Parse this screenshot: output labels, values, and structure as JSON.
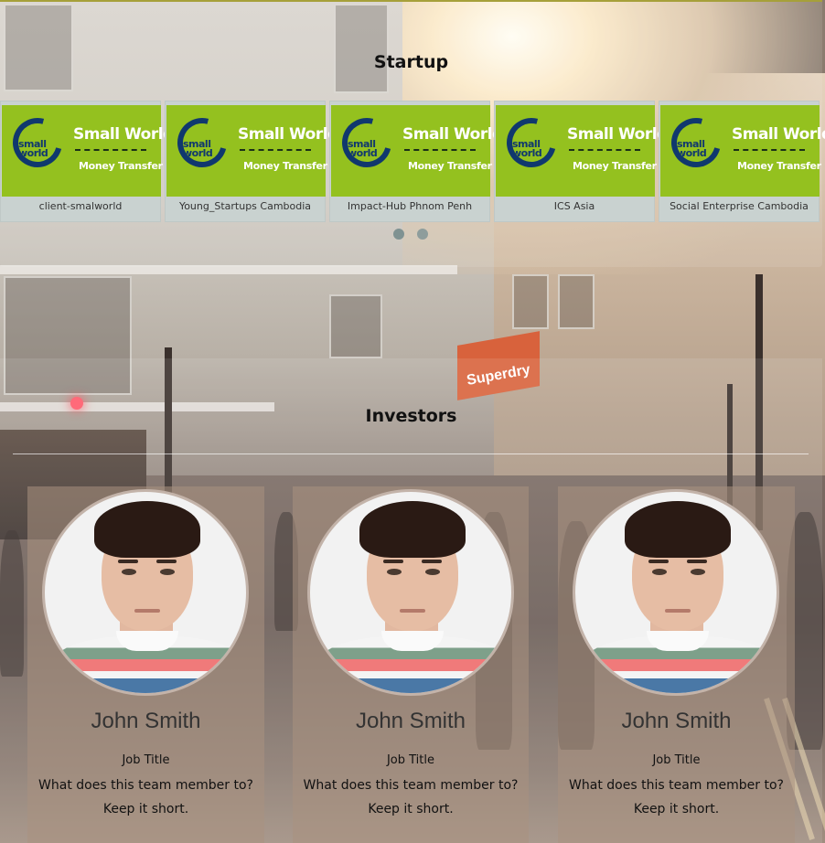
{
  "startup": {
    "title": "Startup",
    "cards": [
      {
        "label": "client-smalworld",
        "logo_title": "Small World",
        "logo_sub": "Money Transfer",
        "logo_small": "small world"
      },
      {
        "label": "Young_Startups Cambodia",
        "logo_title": "Small World",
        "logo_sub": "Money Transfer",
        "logo_small": "small world"
      },
      {
        "label": "Impact-Hub Phnom Penh",
        "logo_title": "Small World",
        "logo_sub": "Money Transfer",
        "logo_small": "small world"
      },
      {
        "label": "ICS Asia",
        "logo_title": "Small World",
        "logo_sub": "Money Transfer",
        "logo_small": "small world"
      },
      {
        "label": "Social Enterprise Cambodia",
        "logo_title": "Small World",
        "logo_sub": "Money Transfer",
        "logo_small": "small world"
      }
    ],
    "pagination_dots": 2
  },
  "investors": {
    "title": "Investors",
    "members": [
      {
        "name": "John Smith",
        "job_title": "Job Title",
        "desc_line1": "What does this team member to?",
        "desc_line2": "Keep it short."
      },
      {
        "name": "John Smith",
        "job_title": "Job Title",
        "desc_line1": "What does this team member to?",
        "desc_line2": "Keep it short."
      },
      {
        "name": "John Smith",
        "job_title": "Job Title",
        "desc_line1": "What does this team member to?",
        "desc_line2": "Keep it short."
      }
    ]
  },
  "background": {
    "shop_sign": "Superdry",
    "colors": {
      "logo_green": "#94c11f",
      "logo_navy": "#10386e",
      "card_bg": "#c9d2d0",
      "dot": "#7f9292"
    }
  }
}
